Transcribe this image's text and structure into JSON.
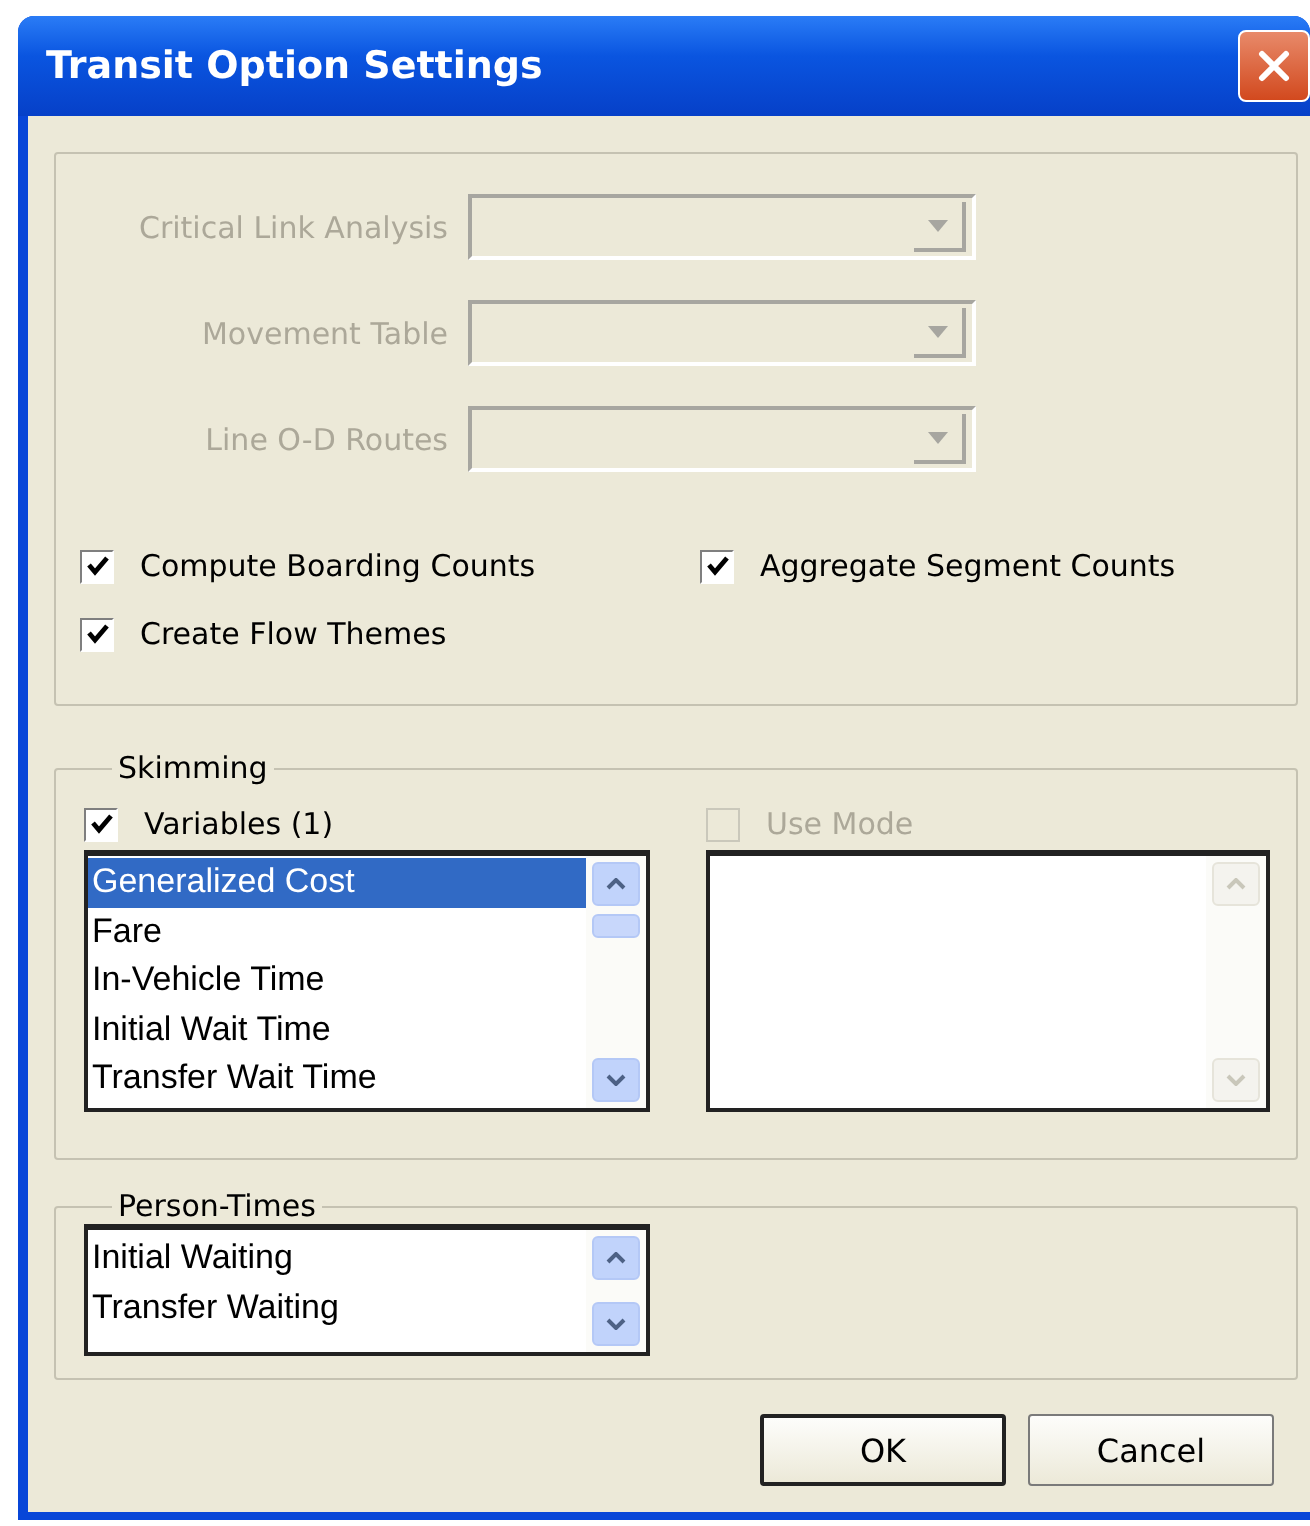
{
  "window": {
    "title": "Transit Option Settings"
  },
  "dropdowns": [
    {
      "label": "Critical Link Analysis",
      "disabled": true
    },
    {
      "label": "Movement Table",
      "disabled": true
    },
    {
      "label": "Line O-D Routes",
      "disabled": true
    }
  ],
  "checkboxes": [
    {
      "label": "Compute Boarding Counts",
      "checked": true
    },
    {
      "label": "Aggregate Segment Counts",
      "checked": true
    },
    {
      "label": "Create Flow Themes",
      "checked": true
    }
  ],
  "skimming": {
    "title": "Skimming",
    "variables": {
      "label": "Variables (1)",
      "checked": true,
      "items": [
        {
          "label": "Generalized Cost",
          "selected": true
        },
        {
          "label": "Fare",
          "selected": false
        },
        {
          "label": "In-Vehicle Time",
          "selected": false
        },
        {
          "label": "Initial Wait Time",
          "selected": false
        },
        {
          "label": "Transfer Wait Time",
          "selected": false
        }
      ]
    },
    "use_mode": {
      "label": "Use Mode",
      "checked": false,
      "disabled": true
    }
  },
  "person_times": {
    "title": "Person-Times",
    "items": [
      {
        "label": "Initial Waiting",
        "selected": false
      },
      {
        "label": "Transfer Waiting",
        "selected": false
      }
    ]
  },
  "buttons": [
    "OK",
    "Cancel"
  ]
}
